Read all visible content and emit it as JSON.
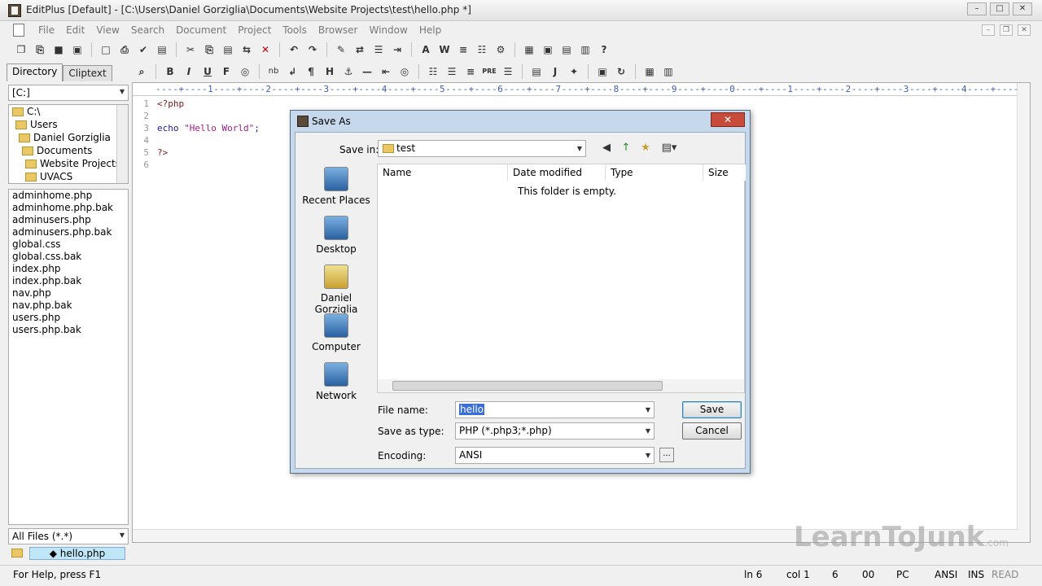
{
  "window": {
    "title": "EditPlus [Default] - [C:\\Users\\Daniel Gorziglia\\Documents\\Website Projects\\test\\hello.php *]",
    "buttons": [
      "–",
      "□",
      "✕"
    ]
  },
  "menu": [
    "File",
    "Edit",
    "View",
    "Search",
    "Document",
    "Project",
    "Tools",
    "Browser",
    "Window",
    "Help"
  ],
  "mdi_buttons": [
    "–",
    "❐",
    "✕"
  ],
  "toolbar1": [
    "❐",
    "⎘",
    "■",
    "▣",
    "□",
    "⎙",
    "✔",
    "▤",
    "✂",
    "⎘",
    "▤",
    "⇆",
    "✕",
    "↶",
    "↷",
    "✎",
    "⇄",
    "☰",
    "⇥",
    "A",
    "W",
    "≡",
    "☷",
    "⚙",
    "▦",
    "▣",
    "▤",
    "▥",
    "?"
  ],
  "toolbar2": [
    "⌕",
    "B",
    "I",
    "U",
    "F",
    "◎",
    "nb",
    "↲",
    "¶",
    "H",
    "⚓",
    "—",
    "⇤",
    "◎",
    "☷",
    "☰",
    "≡",
    "PRE",
    "☰",
    "▤",
    "J",
    "✦",
    "▣",
    "↻",
    "▦",
    "▥"
  ],
  "left_panel": {
    "tabs": [
      "Directory",
      "Cliptext"
    ],
    "drive": "[C:]",
    "tree": [
      "C:\\",
      "Users",
      "Daniel Gorziglia",
      "Documents",
      "Website Projects",
      "UVACS"
    ],
    "files": [
      "adminhome.php",
      "adminhome.php.bak",
      "adminusers.php",
      "adminusers.php.bak",
      "global.css",
      "global.css.bak",
      "index.php",
      "index.php.bak",
      "nav.php",
      "nav.php.bak",
      "users.php",
      "users.php.bak"
    ],
    "filter": "All Files (*.*)"
  },
  "editor": {
    "ruler": "----+----1----+----2----+----3----+----4----+----5----+----6----+----7----+----8----+----9----+----0----+----1----+----2----+----3----+----4----+----5-",
    "lines": [
      {
        "num": "1",
        "text": "<?php"
      },
      {
        "num": "2",
        "text": ""
      },
      {
        "num": "3",
        "kw": "echo ",
        "str": "\"Hello World\"",
        "tail": ";"
      },
      {
        "num": "4",
        "text": ""
      },
      {
        "num": "5",
        "text": "?>"
      },
      {
        "num": "6",
        "text": ""
      }
    ]
  },
  "doc_tab": "◆ hello.php",
  "status": {
    "help": "For Help, press F1",
    "line": "ln 6",
    "col": "col 1",
    "c6": "6",
    "c00": "00",
    "pc": "PC",
    "ansi": "ANSI",
    "ins": "INS",
    "read": "READ"
  },
  "watermark": {
    "main": "LearnToJunk",
    "suffix": ".com"
  },
  "dialog": {
    "title": "Save As",
    "close": "✕",
    "save_in_label": "Save in:",
    "save_in_value": "test",
    "places": [
      "Recent Places",
      "Desktop",
      "Daniel Gorziglia",
      "Computer",
      "Network"
    ],
    "columns": [
      "Name",
      "Date modified",
      "Type",
      "Size"
    ],
    "empty_text": "This folder is empty.",
    "file_name_label": "File name:",
    "file_name_value": "hello",
    "save_type_label": "Save as type:",
    "save_type_value": "PHP (*.php3;*.php)",
    "encoding_label": "Encoding:",
    "encoding_value": "ANSI",
    "encoding_more": "...",
    "save_button": "Save",
    "cancel_button": "Cancel",
    "nav_icons": [
      "◀",
      "↑",
      "★",
      "▤▾"
    ]
  }
}
